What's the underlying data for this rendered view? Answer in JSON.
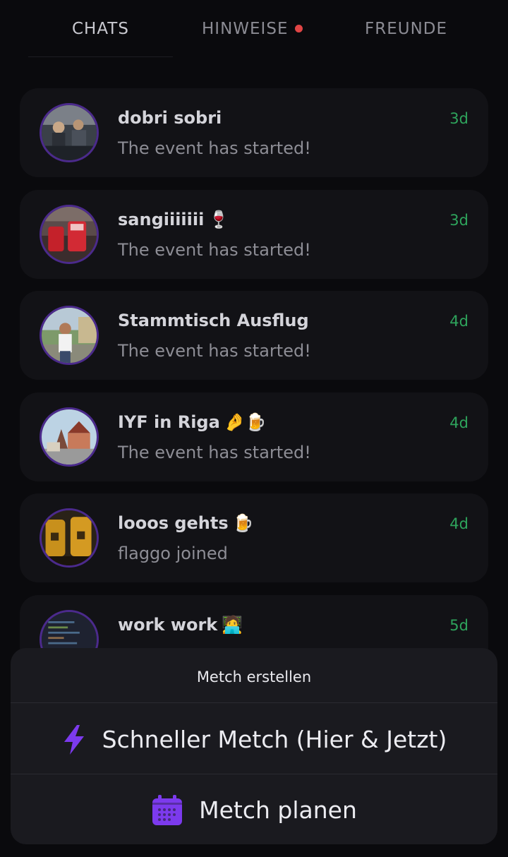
{
  "tabs": {
    "chats": "CHATS",
    "hinweise": "HINWEISE",
    "freunde": "FREUNDE"
  },
  "chats": [
    {
      "name": "dobri sobri",
      "emoji": "",
      "message": "The event has started!",
      "time": "3d",
      "avatar": "group-photo-avatar"
    },
    {
      "name": "sangiiiiiii",
      "emoji": "🍷",
      "message": "The event has started!",
      "time": "3d",
      "avatar": "drinks-avatar"
    },
    {
      "name": "Stammtisch Ausflug",
      "emoji": "",
      "message": "The event has started!",
      "time": "4d",
      "avatar": "person-outdoor-avatar"
    },
    {
      "name": "IYF in Riga",
      "emoji": "🤌🍺",
      "message": "The event has started!",
      "time": "4d",
      "avatar": "riga-building-avatar"
    },
    {
      "name": "looos gehts",
      "emoji": "🍺",
      "message": "flaggo joined",
      "time": "4d",
      "avatar": "beer-glasses-avatar"
    },
    {
      "name": "work work",
      "emoji": "🧑‍💻",
      "message": "",
      "time": "5d",
      "avatar": "code-screen-avatar"
    }
  ],
  "sheet": {
    "title": "Metch erstellen",
    "quick_label": "Schneller Metch (Hier & Jetzt)",
    "plan_label": "Metch planen"
  },
  "colors": {
    "background": "#0a0a0d",
    "card": "#121216",
    "time_green": "#2ea45c",
    "accent_purple": "#7c3aed",
    "notification_red": "#e04545"
  }
}
